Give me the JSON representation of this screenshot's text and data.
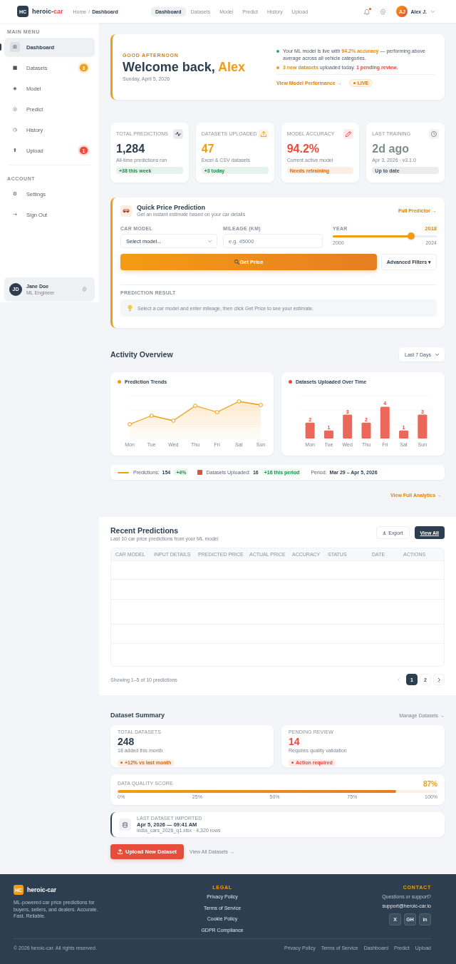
{
  "header": {
    "logo": {
      "mark": "HC",
      "text": [
        {
          "text": "heroic-",
          "kind": "plain"
        },
        {
          "text": "car",
          "kind": "highlight"
        }
      ]
    },
    "breadcrumb": {
      "items": [
        "Home",
        "Dashboard"
      ],
      "separator": "/"
    },
    "nav": [
      {
        "label": "Dashboard",
        "selected": true
      },
      {
        "label": "Datasets",
        "selected": false
      },
      {
        "label": "Model",
        "selected": false
      },
      {
        "label": "Predict",
        "selected": false
      },
      {
        "label": "History",
        "selected": false
      },
      {
        "label": "Upload",
        "selected": false
      }
    ],
    "notifications": {
      "unread": true
    },
    "user": {
      "initials": "AJ",
      "name": "Alex J."
    }
  },
  "sidebar": {
    "sections": [
      {
        "title": "MAIN MENU",
        "items": [
          {
            "icon": "⊞",
            "label": "Dashboard",
            "selected": true
          },
          {
            "icon": "■",
            "label": "Datasets",
            "selected": false,
            "badge": {
              "text": "3",
              "color": "#f39c12"
            }
          },
          {
            "icon": "◈",
            "label": "Model",
            "selected": false
          },
          {
            "icon": "◎",
            "label": "Predict",
            "selected": false
          },
          {
            "icon": "◷",
            "label": "History",
            "selected": false
          },
          {
            "icon": "⬆",
            "label": "Upload",
            "selected": false,
            "badge": {
              "text": "1",
              "color": "#e74c3c"
            }
          }
        ]
      },
      {
        "title": "ACCOUNT",
        "items": [
          {
            "icon": "⚙",
            "label": "Settings",
            "selected": false
          },
          {
            "icon": "→",
            "label": "Sign Out",
            "selected": false
          }
        ]
      }
    ],
    "user": {
      "initials": "JD",
      "name": "Jane Doe",
      "role": "ML Engineer"
    }
  },
  "welcome": {
    "greeting": "GOOD AFTERNOON",
    "title": [
      {
        "text": "Welcome back, ",
        "kind": "plain"
      },
      {
        "text": "Alex",
        "kind": "accent"
      }
    ],
    "date": "Sunday, April 5, 2026",
    "notes": [
      {
        "color": "#27ae60",
        "parts": [
          {
            "text": "Your ML model is live with ",
            "kind": "plain"
          },
          {
            "text": "94.2% accuracy",
            "kind": "accent"
          },
          {
            "text": " — performing above average across all vehicle categories.",
            "kind": "plain"
          }
        ]
      },
      {
        "color": "#f39c12",
        "parts": [
          {
            "text": "3 new datasets",
            "kind": "accent"
          },
          {
            "text": " uploaded today. ",
            "kind": "plain"
          },
          {
            "text": "1 pending review.",
            "kind": "alert"
          }
        ]
      }
    ],
    "link": "View Model Performance →",
    "status": {
      "label": "LIVE",
      "live": true
    }
  },
  "stats": [
    {
      "label": "TOTAL PREDICTIONS",
      "value": "1,284",
      "color": "#2c3e50",
      "note": "All-time predictions run",
      "tag": {
        "text": "+38 this week",
        "color": "#1e8e4e"
      }
    },
    {
      "label": "DATASETS UPLOADED",
      "value": "47",
      "color": "#f39c12",
      "note": "Excel & CSV datasets",
      "tag": {
        "text": "+3 today",
        "color": "#1e8e4e"
      }
    },
    {
      "label": "MODEL ACCURACY",
      "value": "94.2%",
      "color": "#e74c3c",
      "note": "Current active model",
      "tag": {
        "text": "Needs retraining",
        "color": "#d9680b"
      }
    },
    {
      "label": "LAST TRAINING",
      "value": "2d ago",
      "color": "#7f8c8d",
      "note": "Apr 3, 2026 · v3.1.0",
      "tag": {
        "text": "Up to date",
        "color": "#4b5563"
      }
    }
  ],
  "quick_predict": {
    "title": "Quick Price Prediction",
    "subtitle": "Get an instant estimate based on your car details",
    "link": "Full Predictor →",
    "fields": [
      {
        "kind": "select",
        "label": "CAR MODEL",
        "value": "Select model..."
      },
      {
        "kind": "input",
        "label": "MILEAGE (KM)",
        "placeholder": "e.g. 45000"
      },
      {
        "kind": "slider",
        "label": "YEAR",
        "reading": "2018",
        "level": 0.75,
        "min": "2000",
        "max": "2024"
      }
    ],
    "submit": "Get Price",
    "filters": "Advanced Filters ▾",
    "result": {
      "label": "PREDICTION RESULT",
      "message": "Select a car model and enter mileage, then click Get Price to see your estimate."
    }
  },
  "activity": {
    "title": "Activity Overview",
    "range": "Last 7 Days",
    "charts": [
      {
        "kind": "line",
        "title": "Prediction Trends",
        "color": "#f39c12",
        "x_labels": [
          "Mon",
          "Tue",
          "Wed",
          "Thu",
          "Fri",
          "Sat",
          "Sun"
        ]
      },
      {
        "kind": "bar",
        "title": "Datasets Uploaded Over Time",
        "color": "#e74c3c",
        "chart_data": {
          "type": "bar",
          "categories": [
            "Mon",
            "Tue",
            "Wed",
            "Thu",
            "Fri",
            "Sat",
            "Sun"
          ],
          "values": [
            2,
            1,
            3,
            2,
            4,
            1,
            3
          ],
          "data_labels": true
        }
      }
    ],
    "legend": [
      {
        "kind": "line",
        "color": "#f39c12",
        "label": "Predictions:",
        "value": "154",
        "change": "+4%"
      },
      {
        "kind": "square",
        "color": "#e74c3c",
        "label": "Datasets Uploaded:",
        "value": "16",
        "change": "+16 this period"
      }
    ],
    "period": {
      "label": "Period:",
      "value": "Mar 29 – Apr 5, 2026"
    },
    "link": "View Full Analytics →"
  },
  "recent": {
    "title": "Recent Predictions",
    "subtitle": "Last 10 car price predictions from your ML model",
    "actions": [
      {
        "label": "Export",
        "kind": "secondary"
      },
      {
        "label": "View All",
        "kind": "primary"
      }
    ],
    "columns": [
      "CAR MODEL",
      "INPUT DETAILS",
      "PREDICTED PRICE",
      "ACTUAL PRICE",
      "ACCURACY",
      "STATUS",
      "DATE",
      "ACTIONS"
    ],
    "summary": "Showing 1–5 of 10 predictions",
    "pagination": {
      "prev_disabled": true,
      "next_disabled": false,
      "pages": [
        {
          "label": "1",
          "selected": true
        },
        {
          "label": "2",
          "selected": false
        }
      ]
    }
  },
  "datasets": {
    "title": "Dataset Summary",
    "link": "Manage Datasets →",
    "cards": [
      {
        "label": "TOTAL DATASETS",
        "value": "248",
        "color": "#2c3e50",
        "note": "18 added this month",
        "tag": {
          "text": "+12% vs last month",
          "color": "#d9680b"
        }
      },
      {
        "label": "PENDING REVIEW",
        "value": "14",
        "color": "#e74c3c",
        "note": "Requires quality validation",
        "tag": {
          "text": "Action required",
          "color": "#e74c3c"
        }
      }
    ],
    "quality": {
      "label": "DATA QUALITY SCORE",
      "reading": "87%",
      "level": 0.87,
      "ticks": [
        "0%",
        "25%",
        "50%",
        "75%",
        "100%"
      ]
    },
    "last_import": {
      "label": "LAST DATASET IMPORTED",
      "time": "Apr 5, 2026 — 09:41 AM",
      "file": "india_cars_2026_q1.xlsx · 4,320 rows"
    },
    "upload": "Upload New Dataset",
    "view_all": "View All Datasets →"
  },
  "footer": {
    "brand": {
      "mark": "HC",
      "name": "heroic-car",
      "tagline": "ML-powered car price predictions for buyers, sellers, and dealers. Accurate. Fast. Reliable."
    },
    "legal": {
      "title": "LEGAL",
      "links": [
        "Privacy Policy",
        "Terms of Service",
        "Cookie Policy",
        "GDPR Compliance"
      ]
    },
    "contact": {
      "title": "CONTACT",
      "prompt": "Questions or support?",
      "email": "support@heroic-car.io",
      "social": [
        "X",
        "GH",
        "in"
      ]
    },
    "copyright": "© 2026 heroic-car. All rights reserved.",
    "links": [
      "Privacy Policy",
      "Terms of Service",
      "Dashboard",
      "Predict",
      "Upload"
    ]
  }
}
